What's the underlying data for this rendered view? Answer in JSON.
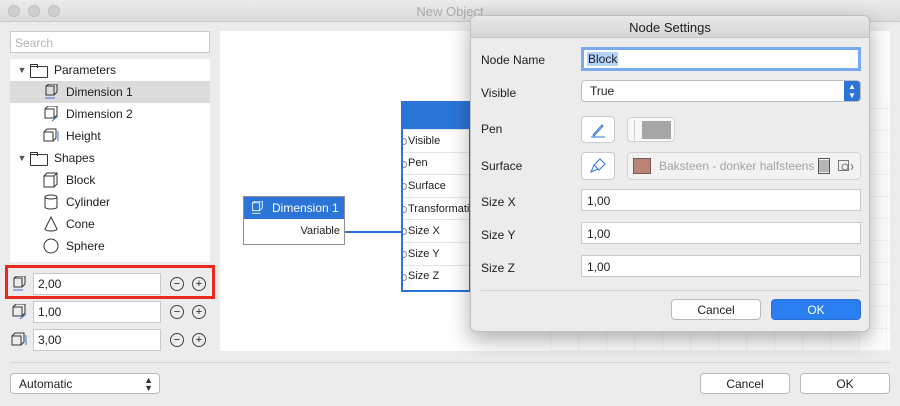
{
  "window": {
    "title": "New Object"
  },
  "search": {
    "placeholder": "Search"
  },
  "tree": {
    "parameters_label": "Parameters",
    "parameters": [
      {
        "label": "Dimension 1",
        "icon": "dimension-x-icon",
        "selected": true
      },
      {
        "label": "Dimension 2",
        "icon": "dimension-y-icon",
        "selected": false
      },
      {
        "label": "Height",
        "icon": "height-icon",
        "selected": false
      }
    ],
    "shapes_label": "Shapes",
    "shapes": [
      {
        "label": "Block",
        "icon": "block-icon"
      },
      {
        "label": "Cylinder",
        "icon": "cylinder-icon"
      },
      {
        "label": "Cone",
        "icon": "cone-icon"
      },
      {
        "label": "Sphere",
        "icon": "sphere-icon"
      }
    ]
  },
  "params": [
    {
      "value": "2,00",
      "icon": "dimension-x-icon",
      "highlighted": true
    },
    {
      "value": "1,00",
      "icon": "dimension-y-icon",
      "highlighted": false
    },
    {
      "value": "3,00",
      "icon": "height-icon",
      "highlighted": false
    }
  ],
  "bottom": {
    "mode_value": "Automatic",
    "cancel": "Cancel",
    "ok": "OK"
  },
  "graph": {
    "dim_node": {
      "title": "Dimension 1",
      "port": "Variable"
    },
    "block_node": {
      "ports": [
        "Visible",
        "Pen",
        "Surface",
        "Transformation",
        "Size X",
        "Size Y",
        "Size Z"
      ]
    },
    "accent": "#2b74d8"
  },
  "dialog": {
    "title": "Node Settings",
    "labels": {
      "node_name": "Node Name",
      "visible": "Visible",
      "pen": "Pen",
      "surface": "Surface",
      "size_x": "Size X",
      "size_y": "Size Y",
      "size_z": "Size Z"
    },
    "node_name_value": "Block",
    "visible_value": "True",
    "surface_value": "Baksteen - donker halfsteens",
    "size_x": "1,00",
    "size_y": "1,00",
    "size_z": "1,00",
    "cancel": "Cancel",
    "ok": "OK"
  }
}
